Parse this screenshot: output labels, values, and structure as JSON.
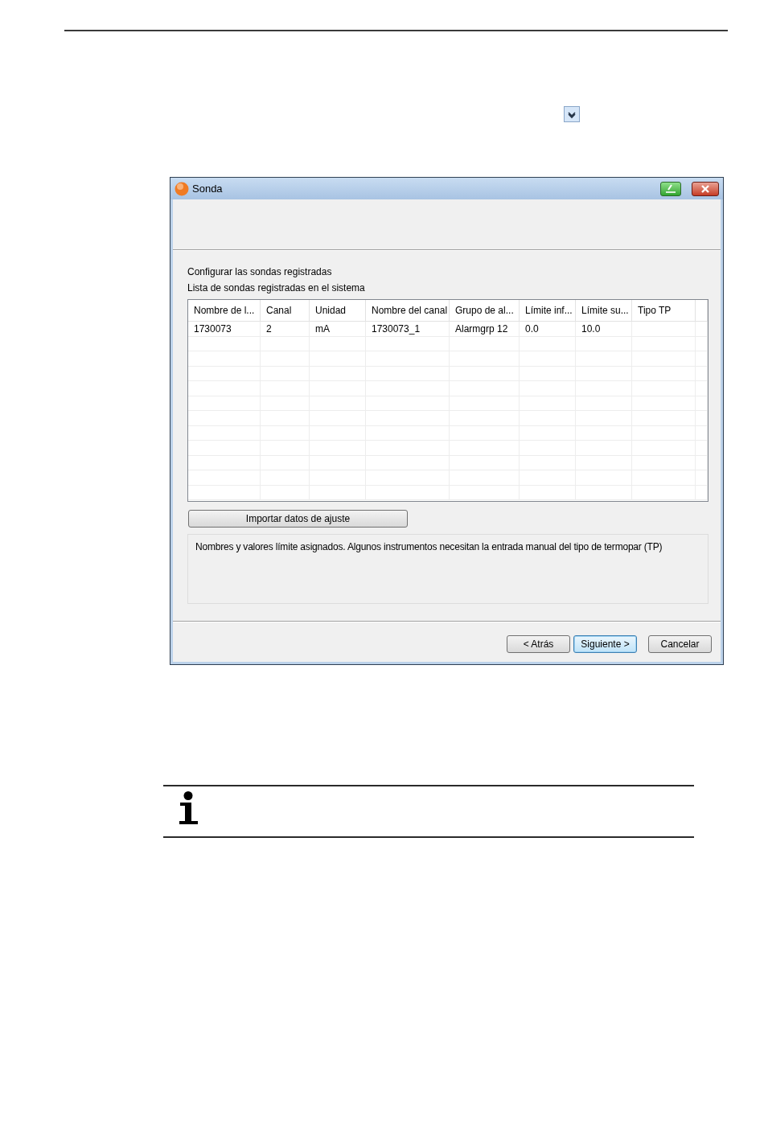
{
  "dialog": {
    "title": "Sonda",
    "heading": "Configurar las sondas registradas",
    "subheading": "Lista de sondas registradas en el sistema",
    "table": {
      "columns": [
        "Nombre de l...",
        "Canal",
        "Unidad",
        "Nombre del canal",
        "Grupo de al...",
        "Límite inf...",
        "Límite su...",
        "Tipo TP"
      ],
      "rows": [
        [
          "1730073",
          "2",
          "mA",
          "1730073_1",
          "Alarmgrp 12",
          "0.0",
          "10.0"
        ]
      ]
    },
    "import_button": "Importar datos de ajuste",
    "info_text": "Nombres y valores límite asignados. Algunos instrumentos necesitan la entrada manual del tipo de termopar (TP)",
    "buttons": [
      {
        "label": "< Atrás",
        "focused": false
      },
      {
        "label": "Siguiente >",
        "focused": true
      },
      {
        "label": "Cancelar",
        "focused": false
      }
    ]
  }
}
